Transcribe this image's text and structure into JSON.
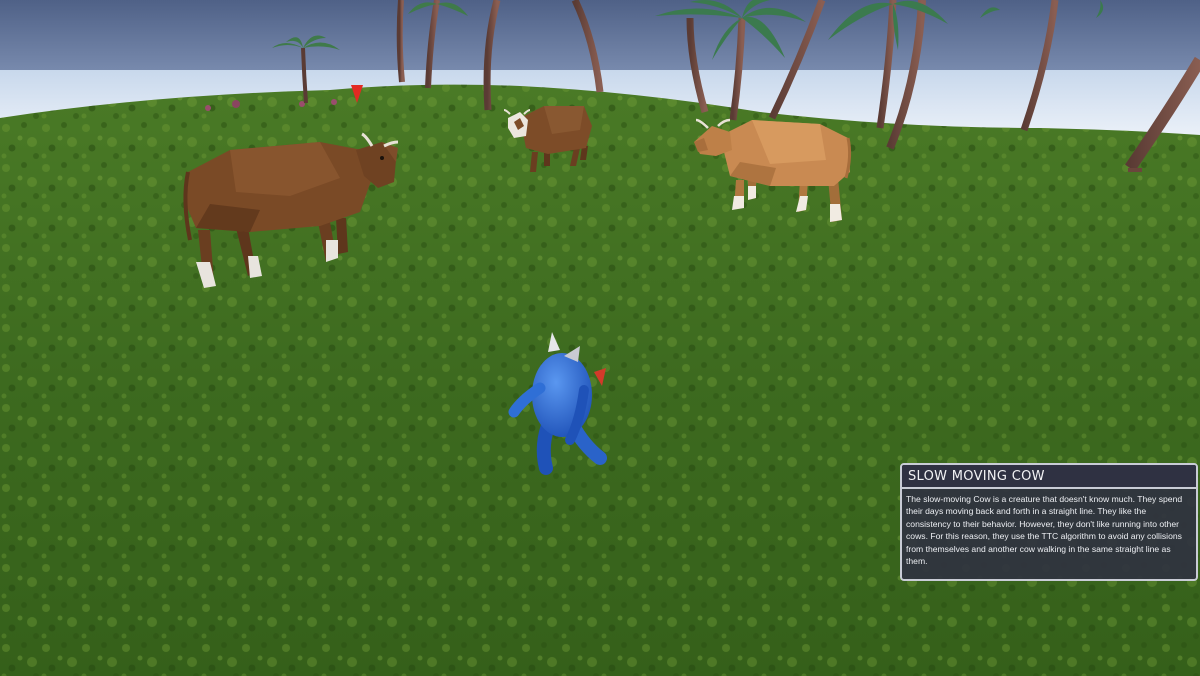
{
  "info_panel": {
    "title": "SLOW MOVING COW",
    "description": "The slow-moving Cow is a creature that doesn't know much. They spend their days moving back and forth in a straight line. They like the consistency to their behavior. However, they don't like running into other cows. For this reason, they use the TTC algorithm to avoid any collisions from themselves and another cow walking in the same straight line as them."
  },
  "colors": {
    "sky": "#5c6f94",
    "ocean": "#dfe9f4",
    "grass": "#3f6b1f",
    "cow_dark_brown": "#7a4a26",
    "cow_tan": "#c98a52",
    "player_blue": "#2f6fd6",
    "panel_background": "#303240",
    "panel_border": "#c9ccd6"
  }
}
